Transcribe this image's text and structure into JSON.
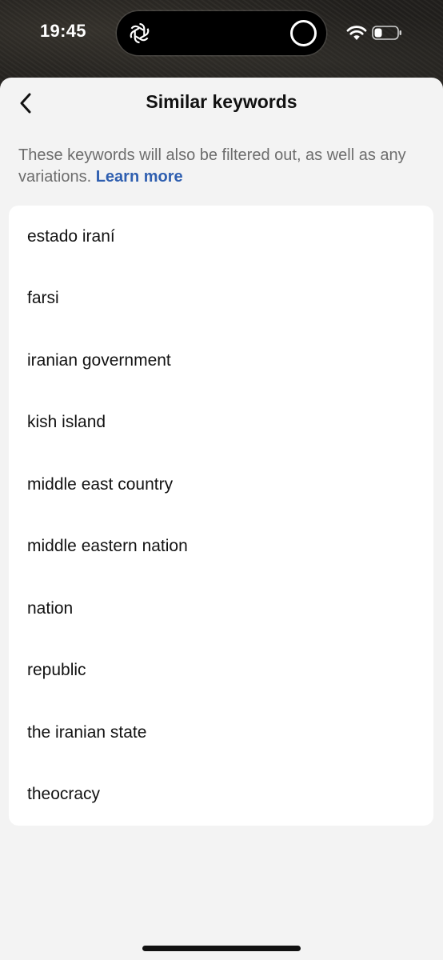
{
  "status_bar": {
    "time": "19:45",
    "island_app_icon": "openai-logo-icon",
    "island_activity_icon": "ring-icon",
    "wifi_icon": "wifi-icon",
    "battery_icon": "battery-icon"
  },
  "header": {
    "back_icon": "chevron-left-icon",
    "title": "Similar keywords"
  },
  "description": {
    "text": "These keywords will also be filtered out, as well as any variations.",
    "link_label": "Learn more"
  },
  "keywords": [
    "estado iraní",
    "farsi",
    "iranian government",
    "kish island",
    "middle east country",
    "middle eastern nation",
    "nation",
    "republic",
    "the iranian state",
    "theocracy"
  ],
  "colors": {
    "sheet_background": "#f3f3f3",
    "card_background": "#ffffff",
    "link": "#2f5fb0",
    "secondary_text": "#6d6d6d"
  }
}
